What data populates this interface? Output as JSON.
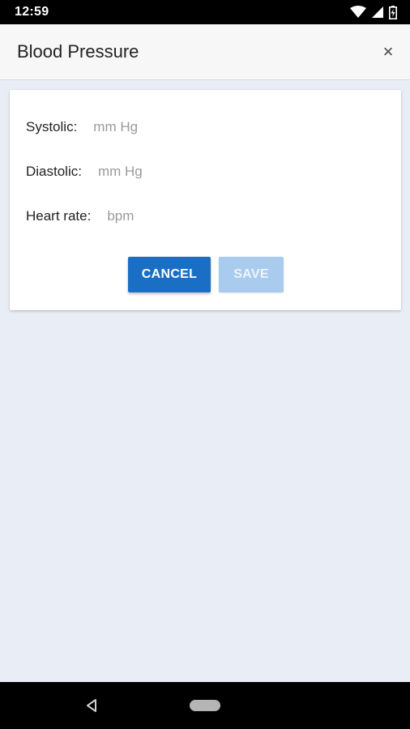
{
  "status_bar": {
    "time": "12:59",
    "icons": [
      "wifi-icon",
      "signal-icon",
      "battery-icon"
    ]
  },
  "app_bar": {
    "title": "Blood Pressure",
    "close_icon": "×"
  },
  "form": {
    "systolic": {
      "label": "Systolic:",
      "placeholder": "mm Hg",
      "value": ""
    },
    "diastolic": {
      "label": "Diastolic:",
      "placeholder": "mm Hg",
      "value": ""
    },
    "heart_rate": {
      "label": "Heart rate:",
      "placeholder": "bpm",
      "value": ""
    }
  },
  "actions": {
    "cancel_label": "CANCEL",
    "save_label": "SAVE"
  },
  "colors": {
    "primary": "#1a6fc4",
    "primary_disabled": "#a8cbee",
    "background": "#e9edf5"
  },
  "nav_bar": {
    "icons": [
      "back-icon",
      "home-icon"
    ]
  }
}
